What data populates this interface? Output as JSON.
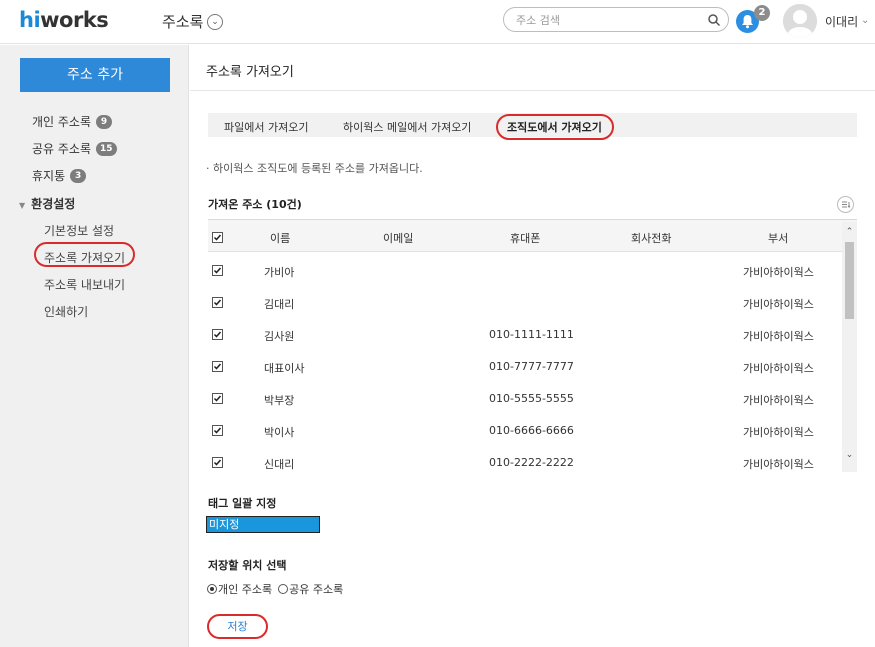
{
  "header": {
    "logo_hi": "hi",
    "logo_rest": "works",
    "app_title": "주소록",
    "search_placeholder": "주소 검색",
    "notification_count": "2",
    "user_name": "이대리"
  },
  "sidebar": {
    "add_button": "주소 추가",
    "items": [
      {
        "label": "개인 주소록",
        "count": "9"
      },
      {
        "label": "공유 주소록",
        "count": "15"
      },
      {
        "label": "휴지통",
        "count": "3"
      }
    ],
    "section": "환경설정",
    "sub_items": [
      "기본정보 설정",
      "주소록 가져오기",
      "주소록 내보내기",
      "인쇄하기"
    ]
  },
  "main": {
    "page_title": "주소록 가져오기",
    "tabs": [
      "파일에서 가져오기",
      "하이웍스 메일에서 가져오기",
      "조직도에서 가져오기"
    ],
    "description": "· 하이웍스 조직도에 등록된 주소를 가져옵니다.",
    "imported_title": "가져온 주소 (10건)",
    "columns": [
      "이름",
      "이메일",
      "휴대폰",
      "회사전화",
      "부서"
    ],
    "rows": [
      {
        "name": "가비아",
        "email": "",
        "mobile": "",
        "phone": "",
        "dept": "가비아하이웍스"
      },
      {
        "name": "김대리",
        "email": "",
        "mobile": "",
        "phone": "",
        "dept": "가비아하이웍스"
      },
      {
        "name": "김사원",
        "email": "",
        "mobile": "010-1111-1111",
        "phone": "",
        "dept": "가비아하이웍스"
      },
      {
        "name": "대표이사",
        "email": "",
        "mobile": "010-7777-7777",
        "phone": "",
        "dept": "가비아하이웍스"
      },
      {
        "name": "박부장",
        "email": "",
        "mobile": "010-5555-5555",
        "phone": "",
        "dept": "가비아하이웍스"
      },
      {
        "name": "박이사",
        "email": "",
        "mobile": "010-6666-6666",
        "phone": "",
        "dept": "가비아하이웍스"
      },
      {
        "name": "신대리",
        "email": "",
        "mobile": "010-2222-2222",
        "phone": "",
        "dept": "가비아하이웍스"
      }
    ],
    "tag_title": "태그 일괄 지정",
    "tag_value": "미지정",
    "location_title": "저장할 위치 선택",
    "location_options": [
      "개인 주소록",
      "공유 주소록"
    ],
    "save_button": "저장"
  },
  "colors": {
    "brand": "#2e8ad8",
    "highlight": "#d92b2b",
    "tag_select": "#1a97dc"
  }
}
